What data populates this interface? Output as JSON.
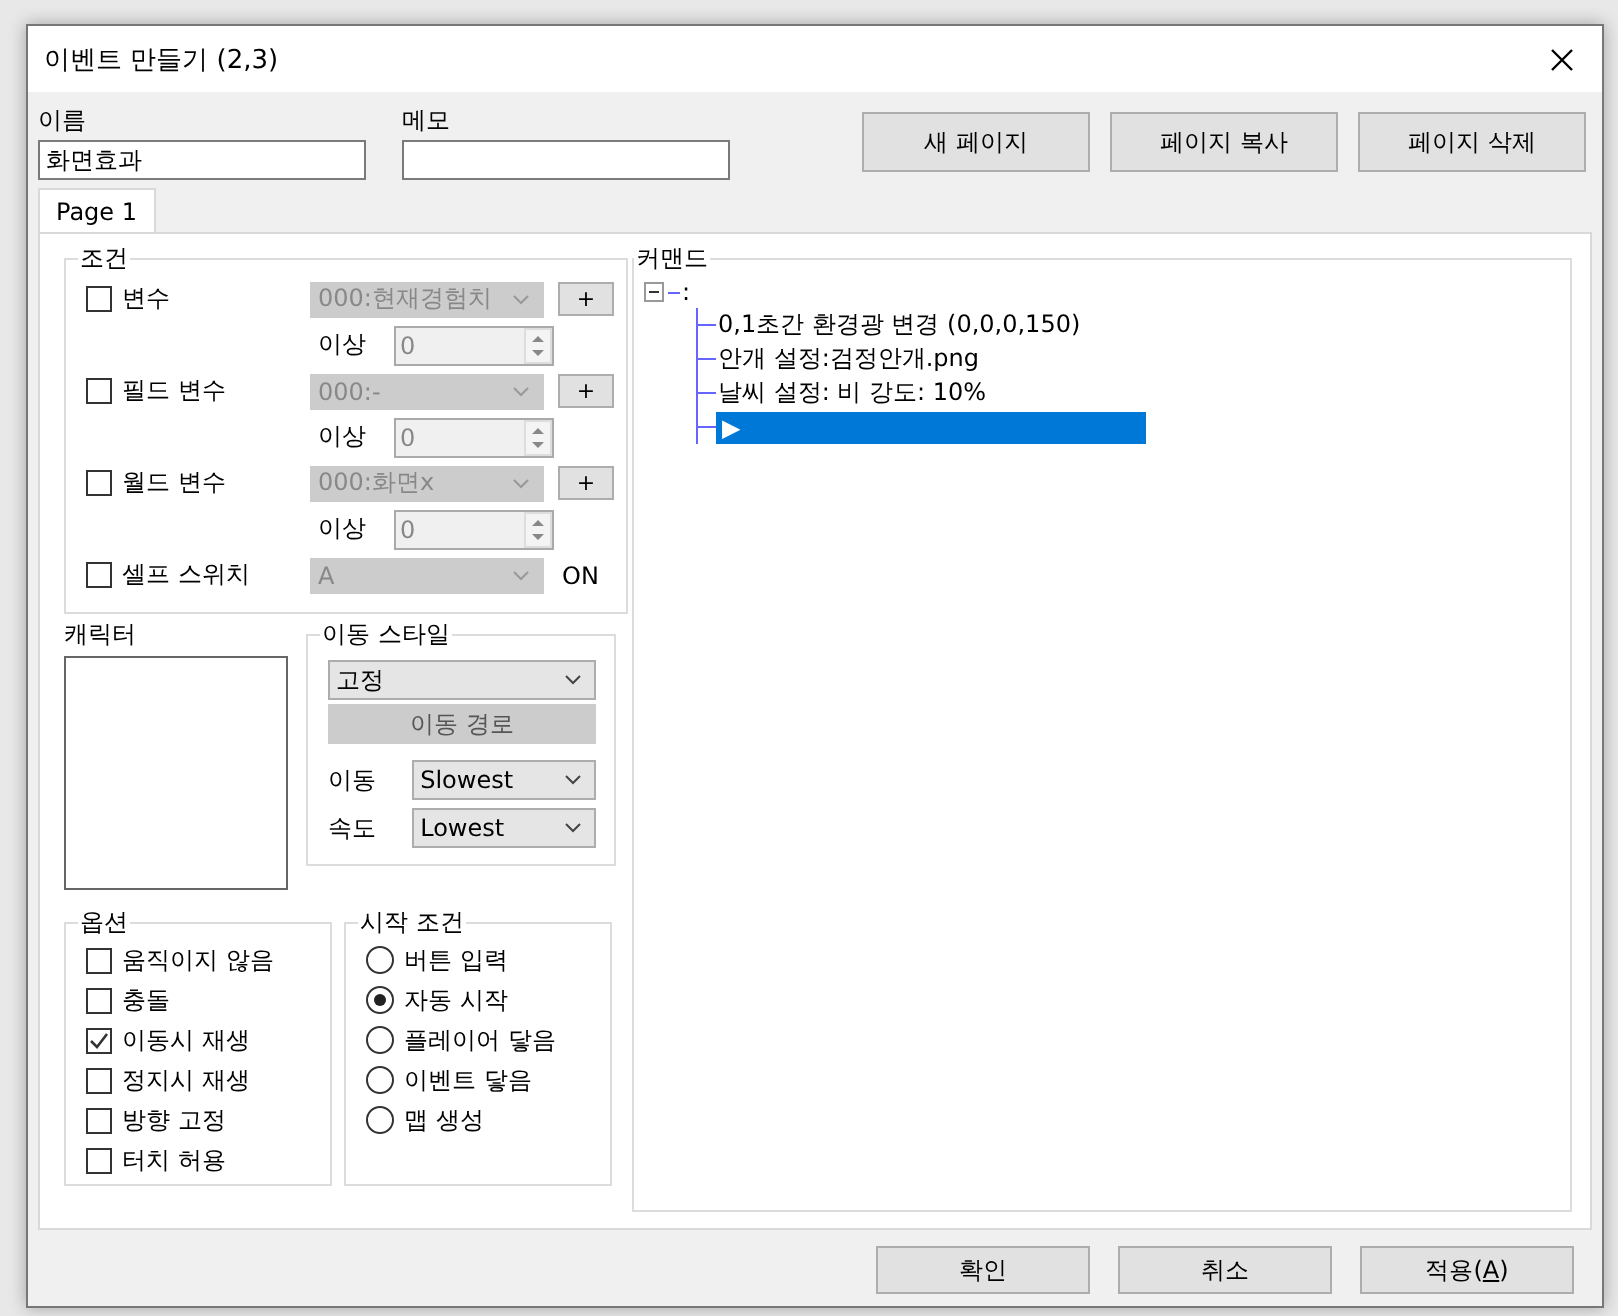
{
  "window": {
    "title": "이벤트 만들기 (2,3)"
  },
  "name_field": {
    "label": "이름",
    "value": "화면효과"
  },
  "memo_field": {
    "label": "메모"
  },
  "page_buttons": [
    "새 페이지",
    "페이지 복사",
    "페이지 삭제"
  ],
  "tabs": [
    {
      "label": "Page 1",
      "selected": true
    }
  ],
  "conditions": {
    "title": "조건",
    "rows": [
      {
        "kind": "variable",
        "label": "변수",
        "checked": false,
        "disabled": true,
        "value": "000:현재경험치",
        "compare": "이상",
        "number": "0",
        "add": "+"
      },
      {
        "kind": "variable",
        "label": "필드 변수",
        "checked": false,
        "disabled": true,
        "value": "000:-",
        "compare": "이상",
        "number": "0",
        "add": "+"
      },
      {
        "kind": "variable",
        "label": "월드 변수",
        "checked": false,
        "disabled": true,
        "value": "000:화면x",
        "compare": "이상",
        "number": "0",
        "add": "+"
      },
      {
        "kind": "switch",
        "label": "셀프 스위치",
        "checked": false,
        "disabled": true,
        "value": "A",
        "suffix": "ON"
      }
    ]
  },
  "character": {
    "title": "캐릭터"
  },
  "move_style": {
    "title": "이동 스타일",
    "type": "고정",
    "route_button": {
      "label": "이동 경로",
      "disabled": true
    },
    "rows": [
      {
        "label": "이동",
        "value": "Slowest"
      },
      {
        "label": "속도",
        "value": "Lowest"
      }
    ]
  },
  "options": {
    "title": "옵션",
    "items": [
      {
        "label": "움직이지 않음",
        "checked": false
      },
      {
        "label": "충돌",
        "checked": false
      },
      {
        "label": "이동시 재생",
        "checked": true
      },
      {
        "label": "정지시 재생",
        "checked": false
      },
      {
        "label": "방향 고정",
        "checked": false
      },
      {
        "label": "터치 허용",
        "checked": false
      }
    ]
  },
  "start": {
    "title": "시작 조건",
    "items": [
      {
        "label": "버튼 입력",
        "selected": false
      },
      {
        "label": "자동 시작",
        "selected": true
      },
      {
        "label": "플레이어 닿음",
        "selected": false
      },
      {
        "label": "이벤트 닿음",
        "selected": false
      },
      {
        "label": "맵 생성",
        "selected": false
      }
    ]
  },
  "commands": {
    "title": "커맨드",
    "root": {
      "text": ":",
      "expanded": true,
      "children": [
        {
          "kind": "command",
          "text": "0,1초간 환경광 변경 (0,0,0,150)",
          "selected": false
        },
        {
          "kind": "command",
          "text": "안개 설정:검정안개.png",
          "selected": false
        },
        {
          "kind": "command",
          "text": "날씨 설정: 비 강도: 10%",
          "selected": false
        },
        {
          "kind": "cursor",
          "text": "▶",
          "selected": true
        }
      ]
    }
  },
  "buttons": [
    {
      "before": "확인"
    },
    {
      "before": "취소"
    },
    {
      "before": "적용(",
      "mnemonic": "A",
      "after": ")"
    }
  ]
}
